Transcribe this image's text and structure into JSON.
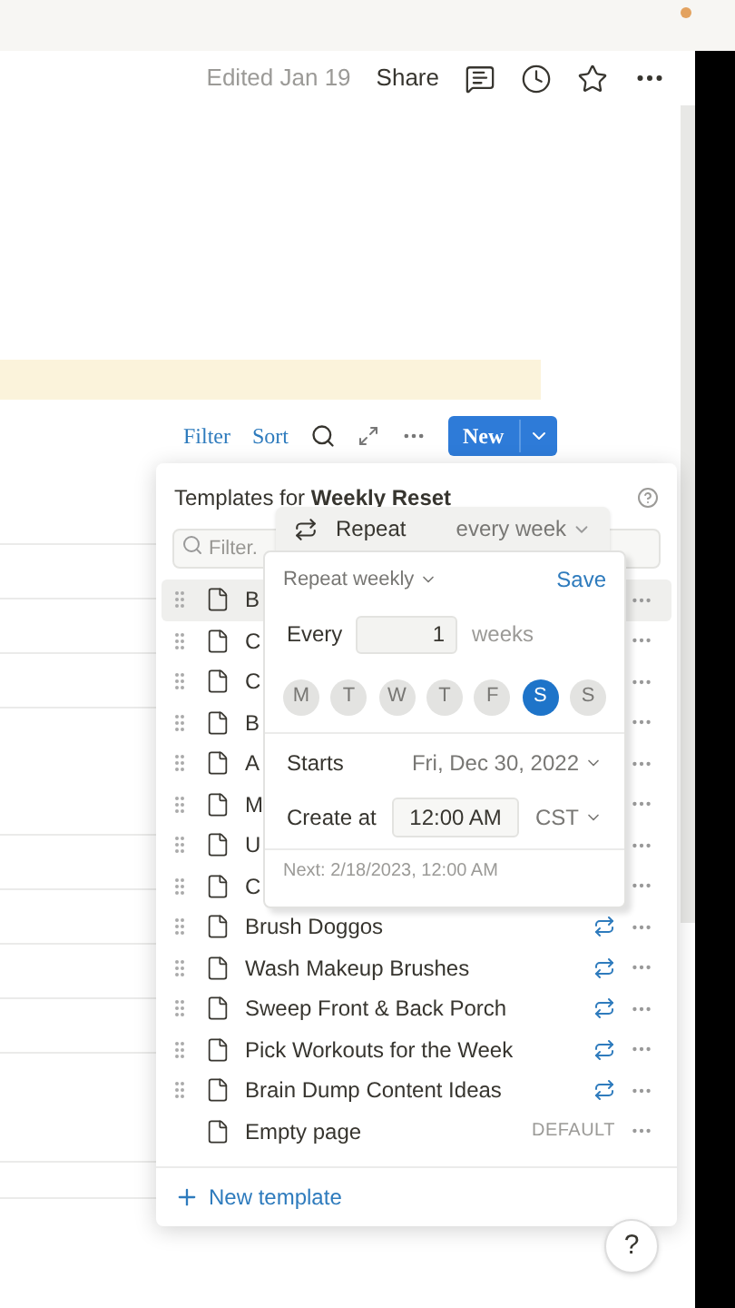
{
  "header": {
    "edited": "Edited Jan 19",
    "share": "Share"
  },
  "toolbar": {
    "filter": "Filter",
    "sort": "Sort",
    "new": "New"
  },
  "templates": {
    "title_prefix": "Templates for ",
    "title_name": "Weekly Reset",
    "filter_placeholder": "Filter.",
    "new_template": "New template",
    "rows": [
      {
        "name": "B",
        "selected": true,
        "repeat": false,
        "draggable": true
      },
      {
        "name": "C",
        "selected": false,
        "repeat": false,
        "draggable": true
      },
      {
        "name": "C",
        "selected": false,
        "repeat": false,
        "draggable": true
      },
      {
        "name": "B",
        "selected": false,
        "repeat": false,
        "draggable": true
      },
      {
        "name": "A",
        "selected": false,
        "repeat": false,
        "draggable": true
      },
      {
        "name": "M",
        "selected": false,
        "repeat": false,
        "draggable": true
      },
      {
        "name": "U",
        "selected": false,
        "repeat": false,
        "draggable": true
      },
      {
        "name": "C",
        "selected": false,
        "repeat": false,
        "draggable": true
      },
      {
        "name": "Brush Doggos",
        "selected": false,
        "repeat": true,
        "draggable": true
      },
      {
        "name": "Wash Makeup Brushes",
        "selected": false,
        "repeat": true,
        "draggable": true
      },
      {
        "name": "Sweep Front & Back Porch",
        "selected": false,
        "repeat": true,
        "draggable": true
      },
      {
        "name": "Pick Workouts for the Week",
        "selected": false,
        "repeat": true,
        "draggable": true
      },
      {
        "name": "Brain Dump Content Ideas",
        "selected": false,
        "repeat": true,
        "draggable": true
      },
      {
        "name": "Empty page",
        "selected": false,
        "repeat": false,
        "draggable": false,
        "badge": "DEFAULT"
      }
    ]
  },
  "repeat_bar": {
    "label": "Repeat",
    "value": "every week"
  },
  "repeat_popover": {
    "mode": "Repeat weekly",
    "save": "Save",
    "every_label": "Every",
    "every_value": "1",
    "every_unit": "weeks",
    "days": [
      {
        "label": "M",
        "selected": false
      },
      {
        "label": "T",
        "selected": false
      },
      {
        "label": "W",
        "selected": false
      },
      {
        "label": "T",
        "selected": false
      },
      {
        "label": "F",
        "selected": false
      },
      {
        "label": "S",
        "selected": true
      },
      {
        "label": "S",
        "selected": false
      }
    ],
    "starts_label": "Starts",
    "starts_value": "Fri, Dec 30, 2022",
    "create_label": "Create at",
    "create_time": "12:00 AM",
    "timezone": "CST",
    "next": "Next: 2/18/2023, 12:00 AM"
  },
  "help": "?"
}
